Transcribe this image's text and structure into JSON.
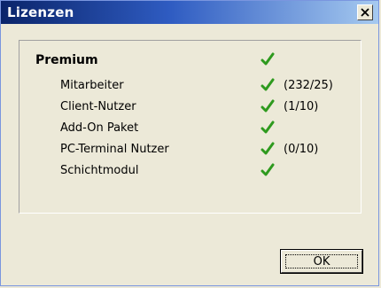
{
  "window": {
    "title": "Lizenzen",
    "close_icon": "close-icon"
  },
  "licenses": {
    "check_color": "#2e9a1e",
    "main": {
      "name": "Premium",
      "icon": "checkmark-icon"
    },
    "items": [
      {
        "name": "Mitarbeiter",
        "icon": "checkmark-icon",
        "count": "(232/25)"
      },
      {
        "name": "Client-Nutzer",
        "icon": "checkmark-icon",
        "count": "(1/10)"
      },
      {
        "name": "Add-On Paket",
        "icon": "checkmark-icon",
        "count": ""
      },
      {
        "name": "PC-Terminal Nutzer",
        "icon": "checkmark-icon",
        "count": "(0/10)"
      },
      {
        "name": "Schichtmodul",
        "icon": "checkmark-icon",
        "count": ""
      }
    ]
  },
  "footer": {
    "ok_label": "OK"
  }
}
